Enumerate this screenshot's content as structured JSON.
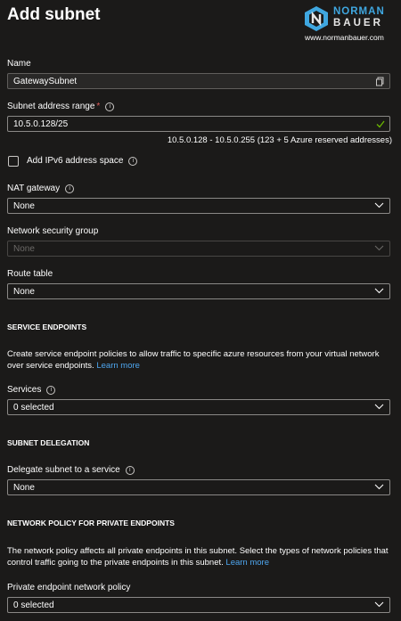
{
  "title": "Add subnet",
  "logo": {
    "line1": "NORMAN",
    "line2": "BAUER",
    "url": "www.normanbauer.com"
  },
  "name": {
    "label": "Name",
    "value": "GatewaySubnet"
  },
  "subnet_range": {
    "label": "Subnet address range",
    "required_mark": "*",
    "value": "10.5.0.128/25",
    "hint": "10.5.0.128 - 10.5.0.255 (123 + 5 Azure reserved addresses)"
  },
  "ipv6": {
    "label": "Add IPv6 address space",
    "checked": false
  },
  "nat_gateway": {
    "label": "NAT gateway",
    "value": "None"
  },
  "nsg": {
    "label": "Network security group",
    "value": "None",
    "disabled": true
  },
  "route_table": {
    "label": "Route table",
    "value": "None"
  },
  "service_endpoints": {
    "heading": "SERVICE ENDPOINTS",
    "description": "Create service endpoint policies to allow traffic to specific azure resources from your virtual network over service endpoints.",
    "link": "Learn more",
    "services_label": "Services",
    "services_value": "0 selected"
  },
  "delegation": {
    "heading": "SUBNET DELEGATION",
    "label": "Delegate subnet to a service",
    "value": "None"
  },
  "private_endpoints": {
    "heading": "NETWORK POLICY FOR PRIVATE ENDPOINTS",
    "description": "The network policy affects all private endpoints in this subnet. Select the types of network policies that control traffic going to the private endpoints in this subnet.",
    "link": "Learn more",
    "policy_label": "Private endpoint network policy",
    "policy_value": "0 selected"
  },
  "icons": {
    "info": "info-icon",
    "chevron": "chevron-down-icon",
    "copy": "copy-icon",
    "check": "checkmark-icon"
  },
  "colors": {
    "background": "#1b1a19",
    "link": "#4ea6ef",
    "valid": "#6bb700",
    "required": "#e05b5b"
  }
}
